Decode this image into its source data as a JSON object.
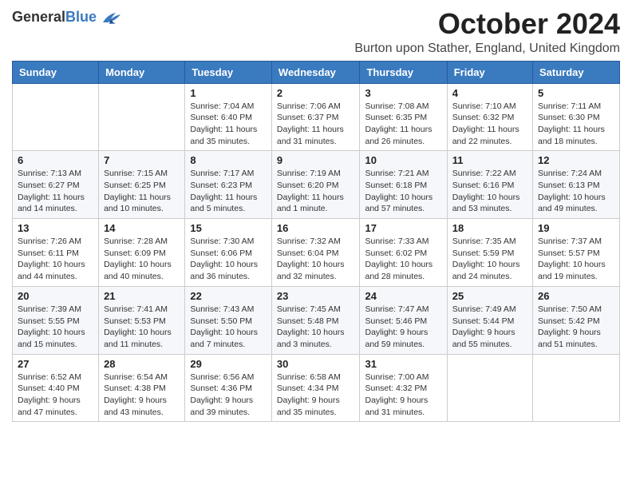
{
  "header": {
    "logo_general": "General",
    "logo_blue": "Blue",
    "month_title": "October 2024",
    "location": "Burton upon Stather, England, United Kingdom"
  },
  "days_of_week": [
    "Sunday",
    "Monday",
    "Tuesday",
    "Wednesday",
    "Thursday",
    "Friday",
    "Saturday"
  ],
  "weeks": [
    [
      {
        "day": "",
        "info": ""
      },
      {
        "day": "",
        "info": ""
      },
      {
        "day": "1",
        "info": "Sunrise: 7:04 AM\nSunset: 6:40 PM\nDaylight: 11 hours and 35 minutes."
      },
      {
        "day": "2",
        "info": "Sunrise: 7:06 AM\nSunset: 6:37 PM\nDaylight: 11 hours and 31 minutes."
      },
      {
        "day": "3",
        "info": "Sunrise: 7:08 AM\nSunset: 6:35 PM\nDaylight: 11 hours and 26 minutes."
      },
      {
        "day": "4",
        "info": "Sunrise: 7:10 AM\nSunset: 6:32 PM\nDaylight: 11 hours and 22 minutes."
      },
      {
        "day": "5",
        "info": "Sunrise: 7:11 AM\nSunset: 6:30 PM\nDaylight: 11 hours and 18 minutes."
      }
    ],
    [
      {
        "day": "6",
        "info": "Sunrise: 7:13 AM\nSunset: 6:27 PM\nDaylight: 11 hours and 14 minutes."
      },
      {
        "day": "7",
        "info": "Sunrise: 7:15 AM\nSunset: 6:25 PM\nDaylight: 11 hours and 10 minutes."
      },
      {
        "day": "8",
        "info": "Sunrise: 7:17 AM\nSunset: 6:23 PM\nDaylight: 11 hours and 5 minutes."
      },
      {
        "day": "9",
        "info": "Sunrise: 7:19 AM\nSunset: 6:20 PM\nDaylight: 11 hours and 1 minute."
      },
      {
        "day": "10",
        "info": "Sunrise: 7:21 AM\nSunset: 6:18 PM\nDaylight: 10 hours and 57 minutes."
      },
      {
        "day": "11",
        "info": "Sunrise: 7:22 AM\nSunset: 6:16 PM\nDaylight: 10 hours and 53 minutes."
      },
      {
        "day": "12",
        "info": "Sunrise: 7:24 AM\nSunset: 6:13 PM\nDaylight: 10 hours and 49 minutes."
      }
    ],
    [
      {
        "day": "13",
        "info": "Sunrise: 7:26 AM\nSunset: 6:11 PM\nDaylight: 10 hours and 44 minutes."
      },
      {
        "day": "14",
        "info": "Sunrise: 7:28 AM\nSunset: 6:09 PM\nDaylight: 10 hours and 40 minutes."
      },
      {
        "day": "15",
        "info": "Sunrise: 7:30 AM\nSunset: 6:06 PM\nDaylight: 10 hours and 36 minutes."
      },
      {
        "day": "16",
        "info": "Sunrise: 7:32 AM\nSunset: 6:04 PM\nDaylight: 10 hours and 32 minutes."
      },
      {
        "day": "17",
        "info": "Sunrise: 7:33 AM\nSunset: 6:02 PM\nDaylight: 10 hours and 28 minutes."
      },
      {
        "day": "18",
        "info": "Sunrise: 7:35 AM\nSunset: 5:59 PM\nDaylight: 10 hours and 24 minutes."
      },
      {
        "day": "19",
        "info": "Sunrise: 7:37 AM\nSunset: 5:57 PM\nDaylight: 10 hours and 19 minutes."
      }
    ],
    [
      {
        "day": "20",
        "info": "Sunrise: 7:39 AM\nSunset: 5:55 PM\nDaylight: 10 hours and 15 minutes."
      },
      {
        "day": "21",
        "info": "Sunrise: 7:41 AM\nSunset: 5:53 PM\nDaylight: 10 hours and 11 minutes."
      },
      {
        "day": "22",
        "info": "Sunrise: 7:43 AM\nSunset: 5:50 PM\nDaylight: 10 hours and 7 minutes."
      },
      {
        "day": "23",
        "info": "Sunrise: 7:45 AM\nSunset: 5:48 PM\nDaylight: 10 hours and 3 minutes."
      },
      {
        "day": "24",
        "info": "Sunrise: 7:47 AM\nSunset: 5:46 PM\nDaylight: 9 hours and 59 minutes."
      },
      {
        "day": "25",
        "info": "Sunrise: 7:49 AM\nSunset: 5:44 PM\nDaylight: 9 hours and 55 minutes."
      },
      {
        "day": "26",
        "info": "Sunrise: 7:50 AM\nSunset: 5:42 PM\nDaylight: 9 hours and 51 minutes."
      }
    ],
    [
      {
        "day": "27",
        "info": "Sunrise: 6:52 AM\nSunset: 4:40 PM\nDaylight: 9 hours and 47 minutes."
      },
      {
        "day": "28",
        "info": "Sunrise: 6:54 AM\nSunset: 4:38 PM\nDaylight: 9 hours and 43 minutes."
      },
      {
        "day": "29",
        "info": "Sunrise: 6:56 AM\nSunset: 4:36 PM\nDaylight: 9 hours and 39 minutes."
      },
      {
        "day": "30",
        "info": "Sunrise: 6:58 AM\nSunset: 4:34 PM\nDaylight: 9 hours and 35 minutes."
      },
      {
        "day": "31",
        "info": "Sunrise: 7:00 AM\nSunset: 4:32 PM\nDaylight: 9 hours and 31 minutes."
      },
      {
        "day": "",
        "info": ""
      },
      {
        "day": "",
        "info": ""
      }
    ]
  ]
}
